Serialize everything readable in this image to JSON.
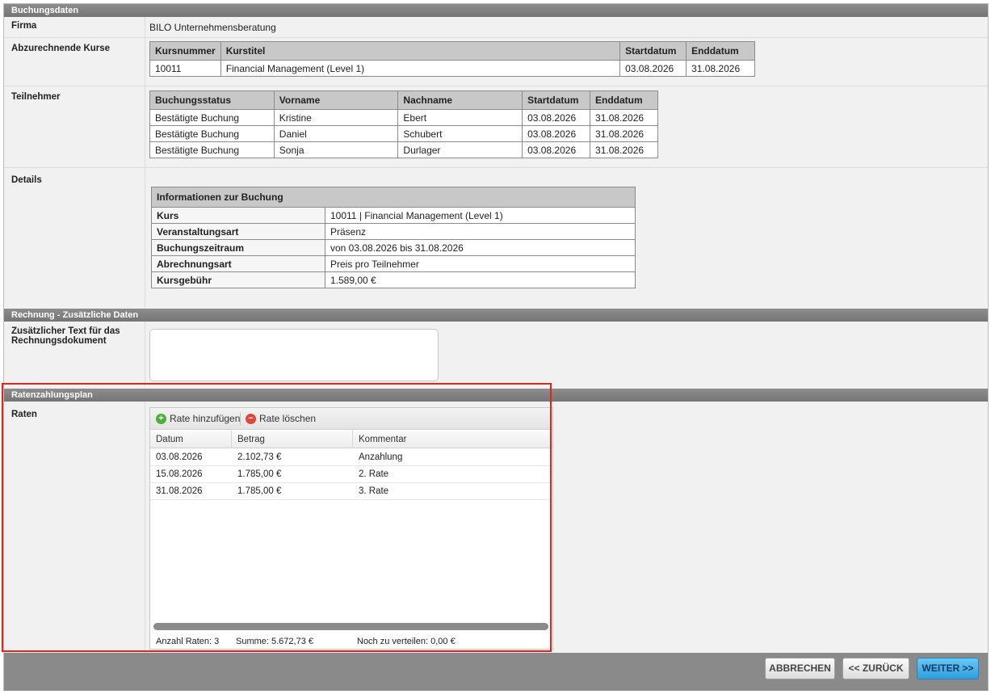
{
  "sections": {
    "booking": "Buchungsdaten",
    "invoice": "Rechnung - Zusätzliche Daten",
    "installments": "Ratenzahlungsplan"
  },
  "firma": {
    "label": "Firma",
    "value": "BILO Unternehmensberatung"
  },
  "courses": {
    "label": "Abzurechnende Kurse",
    "headers": [
      "Kursnummer",
      "Kurstitel",
      "Startdatum",
      "Enddatum"
    ],
    "rows": [
      [
        "10011",
        "Financial Management (Level 1)",
        "03.08.2026",
        "31.08.2026"
      ]
    ]
  },
  "participants": {
    "label": "Teilnehmer",
    "headers": [
      "Buchungsstatus",
      "Vorname",
      "Nachname",
      "Startdatum",
      "Enddatum"
    ],
    "rows": [
      [
        "Bestätigte Buchung",
        "Kristine",
        "Ebert",
        "03.08.2026",
        "31.08.2026"
      ],
      [
        "Bestätigte Buchung",
        "Daniel",
        "Schubert",
        "03.08.2026",
        "31.08.2026"
      ],
      [
        "Bestätigte Buchung",
        "Sonja",
        "Durlager",
        "03.08.2026",
        "31.08.2026"
      ]
    ]
  },
  "details": {
    "label": "Details",
    "title": "Informationen zur Buchung",
    "rows": [
      [
        "Kurs",
        "10011 | Financial Management (Level 1)"
      ],
      [
        "Veranstaltungsart",
        "Präsenz"
      ],
      [
        "Buchungszeitraum",
        "von 03.08.2026 bis 31.08.2026"
      ],
      [
        "Abrechnungsart",
        "Preis pro Teilnehmer"
      ],
      [
        "Kursgebühr",
        "1.589,00 €"
      ]
    ]
  },
  "invoice_text": {
    "label": "Zusätzlicher Text für das Rechnungsdokument",
    "value": ""
  },
  "rates": {
    "label": "Raten",
    "add_label": "Rate hinzufügen",
    "delete_label": "Rate löschen",
    "headers": [
      "Datum",
      "Betrag",
      "Kommentar"
    ],
    "rows": [
      [
        "03.08.2026",
        "2.102,73 €",
        "Anzahlung"
      ],
      [
        "15.08.2026",
        "1.785,00 €",
        "2. Rate"
      ],
      [
        "31.08.2026",
        "1.785,00 €",
        "3. Rate"
      ]
    ],
    "count_text": "Anzahl Raten: 3",
    "sum_text": "Summe: 5.672,73 €",
    "remaining_text": "Noch zu verteilen: 0,00 €"
  },
  "buttons": {
    "cancel": "ABBRECHEN",
    "back": "<< ZURÜCK",
    "next": "WEITER >>"
  },
  "colors": {
    "header_bg": "#7e7e7e",
    "highlight": "#e0261c",
    "primary_button": "#3aa7e0"
  }
}
